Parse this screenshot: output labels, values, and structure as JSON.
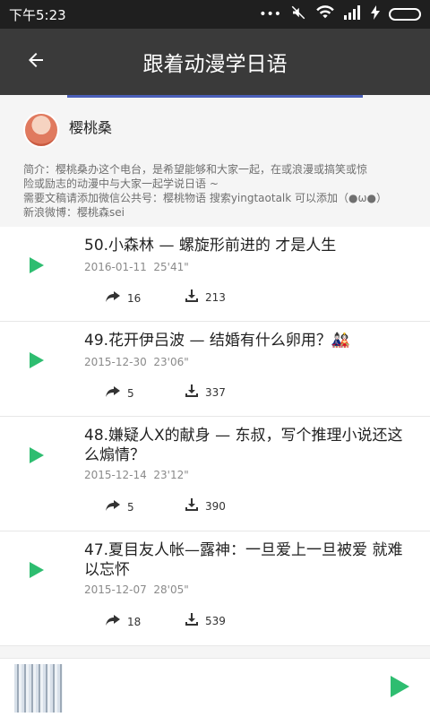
{
  "status_bar": {
    "time": "下午5:23",
    "dots": "•••"
  },
  "app_bar": {
    "title": "跟着动漫学日语"
  },
  "profile": {
    "name": "樱桃桑",
    "intro_lines": [
      "简介：樱桃桑办这个电台，是希望能够和大家一起，在或浪漫或搞笑或惊",
      "险或励志的动漫中与大家一起学说日语 ~",
      "需要文稿请添加微信公共号：樱桃物语 搜索yingtaotalk 可以添加（●ω●）",
      "新浪微博：樱桃森sei"
    ]
  },
  "episodes": [
    {
      "title": "50.小森林 — 螺旋形前进的 才是人生",
      "date": "2016-01-11",
      "duration": "25'41\"",
      "shares": "16",
      "downloads": "213"
    },
    {
      "title": "49.花开伊吕波 — 结婚有什么卵用？🎎",
      "date": "2015-12-30",
      "duration": "23'06\"",
      "shares": "5",
      "downloads": "337"
    },
    {
      "title": "48.嫌疑人X的献身 — 东叔，写个推理小说还这么煽情？",
      "date": "2015-12-14",
      "duration": "23'12\"",
      "shares": "5",
      "downloads": "390"
    },
    {
      "title": "47.夏目友人帐—露神：一旦爱上一旦被爱 就难以忘怀",
      "date": "2015-12-07",
      "duration": "28'05\"",
      "shares": "18",
      "downloads": "539"
    }
  ],
  "colors": {
    "accent": "#2ebd70",
    "app_bar": "#3a3a3a",
    "status_bar": "#1f1f1f"
  },
  "icons": [
    "back-arrow-icon",
    "play-icon",
    "share-icon",
    "download-icon",
    "wifi-icon",
    "signal-icon",
    "battery-icon",
    "mute-icon"
  ]
}
